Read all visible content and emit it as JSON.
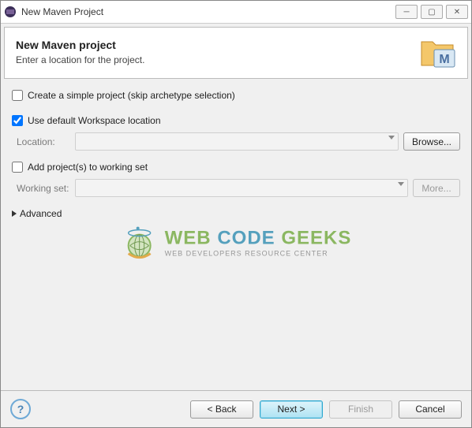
{
  "window": {
    "title": "New Maven Project"
  },
  "header": {
    "title": "New Maven project",
    "subtitle": "Enter a location for the project."
  },
  "options": {
    "simple_project_label": "Create a simple project (skip archetype selection)",
    "simple_project_checked": false,
    "default_workspace_label": "Use default Workspace location",
    "default_workspace_checked": true,
    "location_label": "Location:",
    "location_value": "",
    "browse_label": "Browse...",
    "add_workingset_label": "Add project(s) to working set",
    "add_workingset_checked": false,
    "workingset_label": "Working set:",
    "workingset_value": "",
    "more_label": "More...",
    "advanced_label": "Advanced"
  },
  "footer": {
    "back": "< Back",
    "next": "Next >",
    "finish": "Finish",
    "cancel": "Cancel"
  },
  "watermark": {
    "main_a": "WEB ",
    "main_b": "CODE ",
    "main_c": "GEEKS",
    "sub": "WEB DEVELOPERS RESOURCE CENTER"
  }
}
